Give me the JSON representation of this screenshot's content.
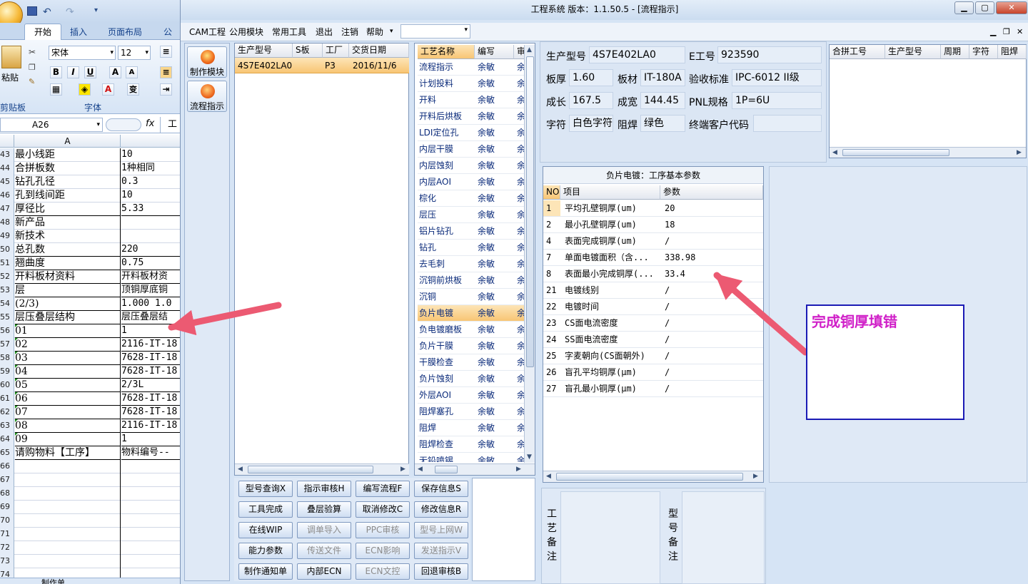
{
  "excel": {
    "tabs": [
      "开始",
      "插入",
      "页面布局",
      "公式"
    ],
    "font_name": "宋体",
    "font_size": "12",
    "group_labels": [
      "剪贴板",
      "字体"
    ],
    "paste_label": "粘贴",
    "namebox": "A26",
    "fx": "fx",
    "formula_value": "工",
    "col_a": "A",
    "sheet_tab": "制作单",
    "rows": [
      {
        "n": "43",
        "a": "最小线距",
        "b": "10"
      },
      {
        "n": "44",
        "a": "合拼板数",
        "b": "1种相同"
      },
      {
        "n": "45",
        "a": "钻孔孔径",
        "b": "0.3"
      },
      {
        "n": "46",
        "a": "孔到线间距",
        "b": "10"
      },
      {
        "n": "47",
        "a": "厚径比",
        "b": "5.33"
      },
      {
        "n": "48",
        "a": "新产品",
        "b": ""
      },
      {
        "n": "49",
        "a": "新技术",
        "b": ""
      },
      {
        "n": "50",
        "a": "总孔数",
        "b": "220"
      },
      {
        "n": "51",
        "a": "翘曲度",
        "b": "0.75"
      },
      {
        "n": "52",
        "a": "开料板材资料",
        "b": "开料板材资"
      },
      {
        "n": "53",
        "a": "层",
        "b": "顶铜厚底铜"
      },
      {
        "n": "54",
        "a": "(2/3)",
        "b": "1.000  1.0"
      },
      {
        "n": "55",
        "a": "层压叠层结构",
        "b": "层压叠层结"
      },
      {
        "n": "56",
        "a": "01",
        "b": "1"
      },
      {
        "n": "57",
        "a": "02",
        "b": "2116-IT-18"
      },
      {
        "n": "58",
        "a": "03",
        "b": "7628-IT-18"
      },
      {
        "n": "59",
        "a": "04",
        "b": "7628-IT-18"
      },
      {
        "n": "60",
        "a": "05",
        "b": "2/3L"
      },
      {
        "n": "61",
        "a": "06",
        "b": "7628-IT-18"
      },
      {
        "n": "62",
        "a": "07",
        "b": "7628-IT-18"
      },
      {
        "n": "63",
        "a": "08",
        "b": "2116-IT-18"
      },
      {
        "n": "64",
        "a": "09",
        "b": "1"
      },
      {
        "n": "65",
        "a": "请购物料【工序】",
        "b": "物料编号--"
      },
      {
        "n": "66",
        "a": "",
        "b": ""
      },
      {
        "n": "67",
        "a": "",
        "b": ""
      },
      {
        "n": "68",
        "a": "",
        "b": ""
      },
      {
        "n": "69",
        "a": "",
        "b": ""
      },
      {
        "n": "70",
        "a": "",
        "b": ""
      },
      {
        "n": "71",
        "a": "",
        "b": ""
      },
      {
        "n": "72",
        "a": "",
        "b": ""
      },
      {
        "n": "73",
        "a": "",
        "b": ""
      },
      {
        "n": "74",
        "a": "",
        "b": ""
      }
    ]
  },
  "window": {
    "title": "工程系统   版本：1.1.50.5 - [流程指示]",
    "menu": [
      "CAM工程",
      "公用模块",
      "常用工具",
      "退出",
      "注销",
      "帮助"
    ],
    "tools": [
      {
        "label": "制作模块",
        "color": "#e8501a"
      },
      {
        "label": "流程指示",
        "color": "#e8501a"
      }
    ]
  },
  "orders": {
    "headers": [
      "生产型号",
      "S板",
      "工厂",
      "交货日期"
    ],
    "rows": [
      {
        "model": "4S7E402LA0",
        "s": "",
        "factory": "P3",
        "date": "2016/11/6"
      }
    ]
  },
  "process": {
    "headers": [
      "工艺名称",
      "编写",
      "审"
    ],
    "author": "余敏",
    "author3": "余",
    "selected_index": 15,
    "steps": [
      "流程指示",
      "计划投料",
      "开料",
      "开料后烘板",
      "LDI定位孔",
      "内层干膜",
      "内层蚀刻",
      "内层AOI",
      "棕化",
      "层压",
      "铝片钻孔",
      "钻孔",
      "去毛刺",
      "沉铜前烘板",
      "沉铜",
      "负片电镀",
      "负电镀磨板",
      "负片干膜",
      "干膜检查",
      "负片蚀刻",
      "外层AOI",
      "阻焊塞孔",
      "阻焊",
      "阻焊检查",
      "无铅喷锡"
    ]
  },
  "actions": [
    {
      "label": "型号查询X",
      "disabled": false
    },
    {
      "label": "指示审核H",
      "disabled": false
    },
    {
      "label": "编写流程F",
      "disabled": false
    },
    {
      "label": "保存信息S",
      "disabled": false
    },
    {
      "label": "工具完成",
      "disabled": false
    },
    {
      "label": "叠层验算",
      "disabled": false
    },
    {
      "label": "取消修改C",
      "disabled": false
    },
    {
      "label": "修改信息R",
      "disabled": false
    },
    {
      "label": "在线WIP",
      "disabled": false
    },
    {
      "label": "调单导入",
      "disabled": true
    },
    {
      "label": "PPC审核",
      "disabled": true
    },
    {
      "label": "型号上网W",
      "disabled": true
    },
    {
      "label": "能力参数",
      "disabled": false
    },
    {
      "label": "传送文件",
      "disabled": true
    },
    {
      "label": "ECN影响",
      "disabled": true
    },
    {
      "label": "发送指示V",
      "disabled": true
    },
    {
      "label": "制作通知单",
      "disabled": false
    },
    {
      "label": "内部ECN",
      "disabled": false
    },
    {
      "label": "ECN文控",
      "disabled": true
    },
    {
      "label": "回退审核B",
      "disabled": false
    }
  ],
  "info": {
    "model_label": "生产型号",
    "model": "4S7E402LA0",
    "e_label": "E工号",
    "e": "923590",
    "thickness_label": "板厚",
    "thickness": "1.60",
    "material_label": "板材",
    "material": "IT-180A",
    "standard_label": "验收标准",
    "standard": "IPC-6012 II级",
    "length_label": "成长",
    "length": "167.5",
    "width_label": "成宽",
    "width": "144.45",
    "pnl_label": "PNL规格",
    "pnl": "1P=6U",
    "char_label": "字符",
    "char": "白色字符",
    "mask_label": "阻焊",
    "mask": "绿色",
    "customer_label": "终端客户代码",
    "customer": ""
  },
  "merge": {
    "headers": [
      "合拼工号",
      "生产型号",
      "周期",
      "字符",
      "阻焊"
    ]
  },
  "params": {
    "title": "负片电镀：工序基本参数",
    "headers": [
      "NO",
      "项目",
      "参数"
    ],
    "rows": [
      {
        "no": "1",
        "item": "平均孔壁铜厚(um)",
        "value": "20"
      },
      {
        "no": "2",
        "item": "最小孔壁铜厚(um)",
        "value": "18"
      },
      {
        "no": "4",
        "item": "表面完成铜厚(um)",
        "value": "/"
      },
      {
        "no": "7",
        "item": "单面电镀面积（含...",
        "value": "338.98"
      },
      {
        "no": "8",
        "item": "表面最小完成铜厚(...",
        "value": "33.4"
      },
      {
        "no": "21",
        "item": "电镀线别",
        "value": "/"
      },
      {
        "no": "22",
        "item": "电镀时间",
        "value": "/"
      },
      {
        "no": "23",
        "item": "CS面电流密度",
        "value": "/"
      },
      {
        "no": "24",
        "item": "SS面电流密度",
        "value": "/"
      },
      {
        "no": "25",
        "item": "字麦朝向(CS面朝外)",
        "value": "/"
      },
      {
        "no": "26",
        "item": "盲孔平均铜厚(μm)",
        "value": "/"
      },
      {
        "no": "27",
        "item": "盲孔最小铜厚(μm)",
        "value": "/"
      }
    ]
  },
  "remarks": {
    "process_label": "工艺备注",
    "model_label": "型号备注"
  },
  "annotation": {
    "text": "完成铜厚填错",
    "arrow_color": "#ec5a72",
    "box_color": "#1b1bb5",
    "text_color": "#d020c8"
  }
}
